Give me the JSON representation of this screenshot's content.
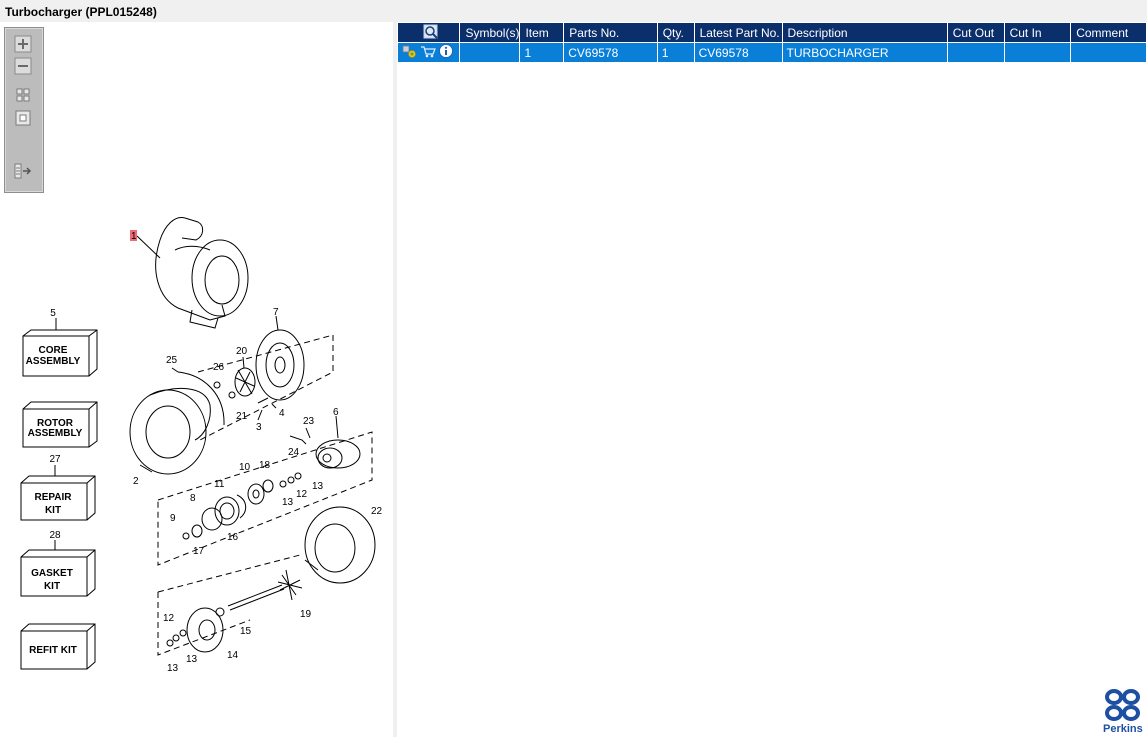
{
  "window": {
    "title": "Turbocharger (PPL015248)"
  },
  "toolbox": {
    "tools": [
      "zoom-in-icon",
      "zoom-out-icon",
      "fit-all-icon",
      "fit-window-icon",
      "show-list-icon"
    ]
  },
  "diagram": {
    "kit_boxes": [
      {
        "number": "5",
        "line1": "CORE",
        "line2": "ASSEMBLY"
      },
      {
        "number": "",
        "line1": "ROTOR",
        "line2": "ASSEMBLY"
      },
      {
        "number": "27",
        "line1": "REPAIR",
        "line2": "KIT"
      },
      {
        "number": "28",
        "line1": "GASKET",
        "line2": "KIT"
      },
      {
        "number": "",
        "line1": "REFIT KIT",
        "line2": ""
      }
    ],
    "callouts": [
      "1",
      "7",
      "25",
      "26",
      "20",
      "21",
      "3",
      "4",
      "2",
      "23",
      "24",
      "6",
      "10",
      "18",
      "11",
      "8",
      "9",
      "17",
      "16",
      "12",
      "13",
      "22",
      "19",
      "15",
      "14"
    ]
  },
  "table": {
    "columns": [
      "Symbol(s)",
      "Item",
      "Parts No.",
      "Qty.",
      "Latest Part No.",
      "Description",
      "Cut Out",
      "Cut In",
      "Comment"
    ],
    "rows": [
      {
        "symbols": "",
        "item": "1",
        "parts_no": "CV69578",
        "qty": "1",
        "latest_part_no": "CV69578",
        "description": "TURBOCHARGER",
        "cut_out": "",
        "cut_in": "",
        "comment": ""
      }
    ]
  },
  "branding": {
    "logo_text": "Perkins"
  },
  "colors": {
    "header_bg": "#0b2f6b",
    "row_selected": "#0a7fd8",
    "callout_highlight": "#ee6b7a"
  }
}
